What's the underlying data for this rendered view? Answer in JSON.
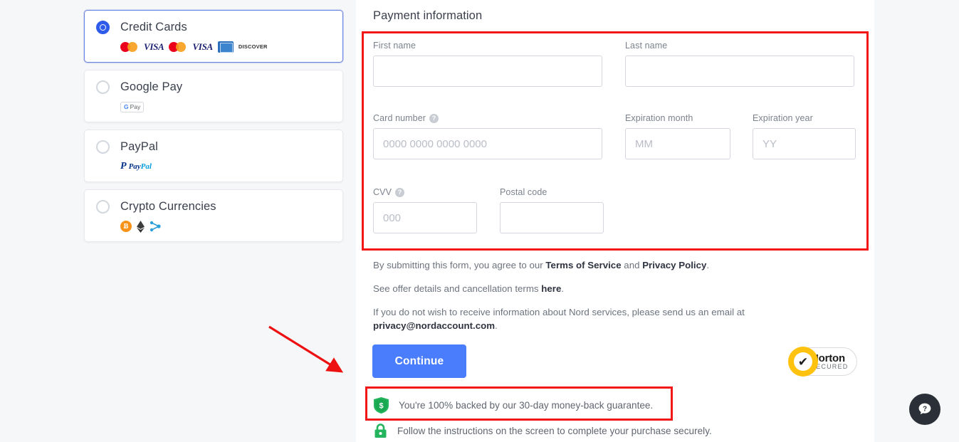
{
  "page": {
    "background_color": "#f6f7f8",
    "panel_color": "#ffffff",
    "accent_color": "#4a7dfc",
    "highlight_color": "#f21818"
  },
  "payment_methods": {
    "items": [
      {
        "id": "credit-cards",
        "label": "Credit Cards",
        "selected": true,
        "logos": [
          "mastercard",
          "visa",
          "mastercard",
          "visa",
          "jcb",
          "discover"
        ],
        "logo_text": {
          "visa": "VISA",
          "discover": "DISCOVER"
        }
      },
      {
        "id": "google-pay",
        "label": "Google Pay",
        "selected": false,
        "logos": [
          "gpay"
        ],
        "logo_text": {
          "gpay_g": "G",
          "gpay_pay": "Pay"
        }
      },
      {
        "id": "paypal",
        "label": "PayPal",
        "selected": false,
        "logos": [
          "paypal"
        ],
        "logo_text": {
          "paypal_pay": "Pay",
          "paypal_pal": "Pal"
        }
      },
      {
        "id": "crypto-currencies",
        "label": "Crypto Currencies",
        "selected": false,
        "logos": [
          "bitcoin",
          "ethereum",
          "ripple"
        ],
        "logo_text": {
          "bitcoin": "Ƀ"
        }
      }
    ]
  },
  "payment_form": {
    "title": "Payment information",
    "fields": {
      "first_name": {
        "label": "First name",
        "value": "",
        "placeholder": ""
      },
      "last_name": {
        "label": "Last name",
        "value": "",
        "placeholder": ""
      },
      "card_number": {
        "label": "Card number",
        "value": "",
        "placeholder": "0000 0000 0000 0000",
        "has_help": true
      },
      "exp_month": {
        "label": "Expiration month",
        "value": "",
        "placeholder": "MM"
      },
      "exp_year": {
        "label": "Expiration year",
        "value": "",
        "placeholder": "YY"
      },
      "cvv": {
        "label": "CVV",
        "value": "",
        "placeholder": "000",
        "has_help": true
      },
      "postal_code": {
        "label": "Postal code",
        "value": "",
        "placeholder": ""
      }
    },
    "help_glyph": "?"
  },
  "legal": {
    "line1_pre": "By submitting this form, you agree to our ",
    "line1_link1": "Terms of Service",
    "line1_mid": " and ",
    "line1_link2": "Privacy Policy",
    "line1_post": ".",
    "line2_pre": "See offer details and cancellation terms ",
    "line2_link": "here",
    "line2_post": ".",
    "line3_pre": "If you do not wish to receive information about Nord services, please send us an email at ",
    "line3_email": "privacy@nordaccount.com",
    "line3_post": "."
  },
  "actions": {
    "continue_label": "Continue"
  },
  "trust": {
    "guarantee_text": "You're 100% backed by our 30-day money-back guarantee.",
    "secure_text": "Follow the instructions on the screen to complete your purchase securely.",
    "guarantee_icon": "shield-dollar-icon",
    "secure_icon": "padlock-icon"
  },
  "norton_badge": {
    "line1": "Norton",
    "line2": "SECURED",
    "check_glyph": "✔"
  },
  "help_fab": {
    "glyph": "?",
    "icon": "question-bubble-icon"
  },
  "annotations": {
    "arrow": "red-arrow-pointing-to-guarantee",
    "box_form": "red-box-around-payment-form",
    "box_guarantee": "red-box-around-guarantee-line"
  }
}
